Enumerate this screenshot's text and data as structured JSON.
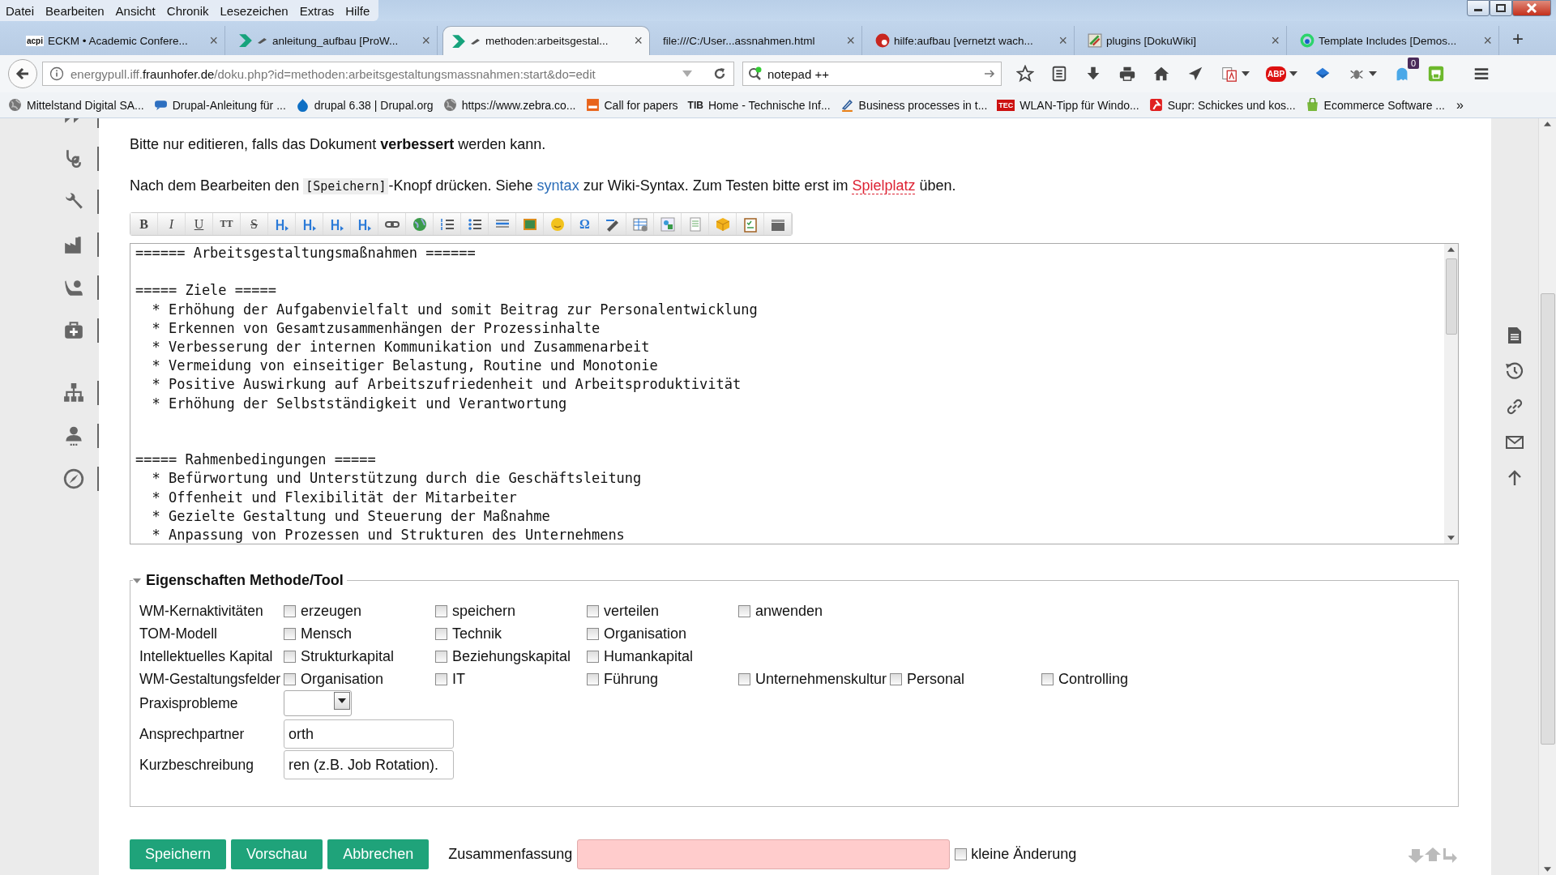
{
  "menu": [
    "Datei",
    "Bearbeiten",
    "Ansicht",
    "Chronik",
    "Lesezeichen",
    "Extras",
    "Hilfe"
  ],
  "tabs": [
    {
      "title": "ECKM • Academic Confere...",
      "selected": false,
      "kind": "text-logo",
      "icon_label": "acpi",
      "editing": false
    },
    {
      "title": "anleitung_aufbau [ProW...",
      "selected": false,
      "kind": "chevron",
      "editing": true
    },
    {
      "title": "methoden:arbeitsgestal...",
      "selected": true,
      "kind": "chevron",
      "editing": true
    },
    {
      "title": "file:///C:/User...assnahmen.html",
      "selected": false,
      "kind": "plain",
      "editing": false
    },
    {
      "title": "hilfe:aufbau [vernetzt wach...",
      "selected": false,
      "kind": "red-gear",
      "editing": false
    },
    {
      "title": "plugins [DokuWiki]",
      "selected": false,
      "kind": "plugin",
      "editing": false
    },
    {
      "title": "Template Includes [Demos...",
      "selected": false,
      "kind": "ring",
      "editing": false
    }
  ],
  "tab_close": "×",
  "new_tab": "+",
  "nav": {
    "url_prefix": "energypull.iff.",
    "url_domain": "fraunhofer.de",
    "url_path": "/doku.php?id=methoden:arbeitsgestaltungsmassnahmen:start&do=edit",
    "search_value": "notepad ++",
    "adblock_label": "ABP",
    "notification_count": "0"
  },
  "bookmarks": [
    {
      "label": "Mittelstand Digital SA...",
      "kind": "globe"
    },
    {
      "label": "Drupal-Anleitung für ...",
      "kind": "chat"
    },
    {
      "label": "drupal 6.38 | Drupal.org",
      "kind": "drop"
    },
    {
      "label": "https://www.zebra.co...",
      "kind": "globe"
    },
    {
      "label": "Call for papers",
      "kind": "orange"
    },
    {
      "label": "Home - Technische Inf...",
      "kind": "text-logo",
      "icon_label": "TIB"
    },
    {
      "label": "Business processes in t...",
      "kind": "pen"
    },
    {
      "label": "WLAN-Tipp für Windo...",
      "kind": "text-logo-red",
      "icon_label": "TEC"
    },
    {
      "label": "Supr: Schickes und kos...",
      "kind": "red"
    },
    {
      "label": "Ecommerce Software ...",
      "kind": "bag"
    }
  ],
  "bookmarks_more": "»",
  "intro": "Bitte nur editieren, falls das Dokument **verbessert** werden kann.",
  "instructions": [
    {
      "kind": "text",
      "text": "Nach dem Bearbeiten den "
    },
    {
      "kind": "code",
      "text": "[Speichern]"
    },
    {
      "kind": "text",
      "text": "-Knopf drücken. Siehe "
    },
    {
      "kind": "link",
      "text": "syntax"
    },
    {
      "kind": "text",
      "text": " zur Wiki-Syntax. Zum Testen bitte erst im "
    },
    {
      "kind": "missing-link",
      "text": "Spielplatz"
    },
    {
      "kind": "text",
      "text": " üben."
    }
  ],
  "toolbar": [
    {
      "kind": "bold",
      "label": "B"
    },
    {
      "kind": "italic",
      "label": "I"
    },
    {
      "kind": "underline",
      "label": "U"
    },
    {
      "kind": "mono",
      "label": "TT"
    },
    {
      "kind": "strike",
      "label": "S"
    },
    {
      "kind": "heading"
    },
    {
      "kind": "heading"
    },
    {
      "kind": "heading"
    },
    {
      "kind": "heading"
    },
    {
      "kind": "link"
    },
    {
      "kind": "globe"
    },
    {
      "kind": "olist"
    },
    {
      "kind": "ulist"
    },
    {
      "kind": "rule"
    },
    {
      "kind": "image"
    },
    {
      "kind": "smiley"
    },
    {
      "kind": "symbol",
      "label": "Ω"
    },
    {
      "kind": "pen"
    },
    {
      "kind": "table"
    },
    {
      "kind": "shapes"
    },
    {
      "kind": "doc"
    },
    {
      "kind": "box"
    },
    {
      "kind": "clipboard"
    },
    {
      "kind": "clapper"
    }
  ],
  "editor": {
    "content": "====== Arbeitsgestaltungsmaßnahmen ======\n\n===== Ziele =====\n  * Erhöhung der Aufgabenvielfalt und somit Beitrag zur Personalentwicklung\n  * Erkennen von Gesamtzusammenhängen der Prozessinhalte\n  * Verbesserung der internen Kommunikation und Zusammenarbeit\n  * Vermeidung von einseitiger Belastung, Routine und Monotonie\n  * Positive Auswirkung auf Arbeitszufriedenheit und Arbeitsproduktivität\n  * Erhöhung der Selbstständigkeit und Verantwortung\n\n\n===== Rahmenbedingungen =====\n  * Befürwortung und Unterstützung durch die Geschäftsleitung\n  * Offenheit und Flexibilität der Mitarbeiter\n  * Gezielte Gestaltung und Steuerung der Maßnahme\n  * Anpassung von Prozessen und Strukturen des Unternehmens"
  },
  "properties": {
    "title": "Eigenschaften Methode/Tool",
    "expanded": true,
    "rows": [
      {
        "label": "WM-Kernaktivitäten",
        "kind": "checkboxes",
        "options": [
          {
            "label": "erzeugen",
            "checked": false
          },
          {
            "label": "speichern",
            "checked": false
          },
          {
            "label": "verteilen",
            "checked": false
          },
          {
            "label": "anwenden",
            "checked": false
          }
        ]
      },
      {
        "label": "TOM-Modell",
        "kind": "checkboxes",
        "options": [
          {
            "label": "Mensch",
            "checked": false
          },
          {
            "label": "Technik",
            "checked": false
          },
          {
            "label": "Organisation",
            "checked": false
          }
        ]
      },
      {
        "label": "Intellektuelles Kapital",
        "kind": "checkboxes",
        "options": [
          {
            "label": "Strukturkapital",
            "checked": false
          },
          {
            "label": "Beziehungskapital",
            "checked": false
          },
          {
            "label": "Humankapital",
            "checked": false
          }
        ]
      },
      {
        "label": "WM-Gestaltungsfelder",
        "kind": "checkboxes",
        "options": [
          {
            "label": "Organisation",
            "checked": false
          },
          {
            "label": "IT",
            "checked": false
          },
          {
            "label": "Führung",
            "checked": false
          },
          {
            "label": "Unternehmenskultur",
            "checked": false
          },
          {
            "label": "Personal",
            "checked": false
          },
          {
            "label": "Controlling",
            "checked": false
          }
        ]
      },
      {
        "label": "Praxisprobleme",
        "kind": "select"
      },
      {
        "label": "Ansprechpartner",
        "kind": "text",
        "value": "orth"
      },
      {
        "label": "Kurzbeschreibung",
        "kind": "text",
        "value": "ren (z.B. Job Rotation)."
      }
    ]
  },
  "actions": [
    "Speichern",
    "Vorschau",
    "Abbrechen"
  ],
  "summary": {
    "label": "Zusammenfassung",
    "minor_label": "kleine Änderung",
    "minor_checked": false
  }
}
